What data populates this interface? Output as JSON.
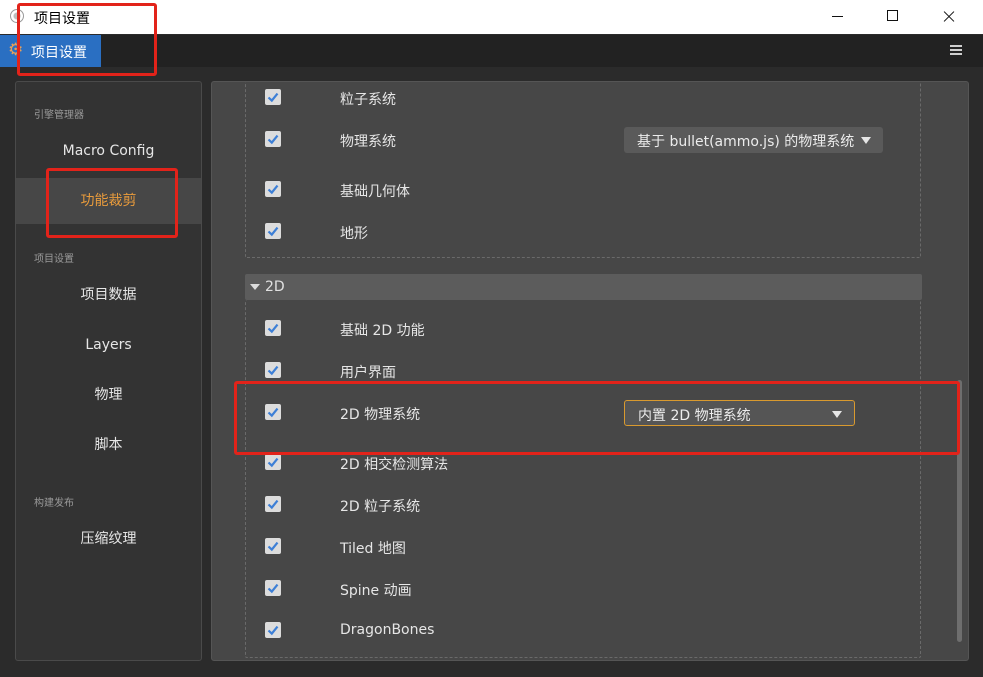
{
  "window": {
    "title": "项目设置"
  },
  "tabbar": {
    "tab_label": "项目设置"
  },
  "sidebar": {
    "sections": [
      {
        "title": "引擎管理器",
        "items": [
          "Macro Config",
          "功能裁剪"
        ]
      },
      {
        "title": "项目设置",
        "items": [
          "项目数据",
          "Layers",
          "物理",
          "脚本"
        ]
      },
      {
        "title": "构建发布",
        "items": [
          "压缩纹理"
        ]
      }
    ],
    "active_item": "功能裁剪"
  },
  "main": {
    "group_3d": {
      "rows": [
        {
          "label": "粒子系统",
          "checked": true
        },
        {
          "label": "物理系统",
          "checked": true,
          "select": "基于 bullet(ammo.js) 的物理系统"
        },
        {
          "label": "基础几何体",
          "checked": true
        },
        {
          "label": "地形",
          "checked": true
        }
      ]
    },
    "group_2d": {
      "title": "2D",
      "rows": [
        {
          "label": "基础 2D 功能",
          "checked": true
        },
        {
          "label": "用户界面",
          "checked": true
        },
        {
          "label": "2D 物理系统",
          "checked": true,
          "select": "内置 2D 物理系统"
        },
        {
          "label": "2D 相交检测算法",
          "checked": true
        },
        {
          "label": "2D 粒子系统",
          "checked": true
        },
        {
          "label": "Tiled 地图",
          "checked": true
        },
        {
          "label": "Spine 动画",
          "checked": true
        },
        {
          "label": "DragonBones",
          "checked": true
        }
      ]
    }
  },
  "colors": {
    "accent": "#2a6fc2",
    "active_text": "#e89b3c",
    "annotation": "#e2231a",
    "checkbox_tick": "#3d7fd6"
  }
}
